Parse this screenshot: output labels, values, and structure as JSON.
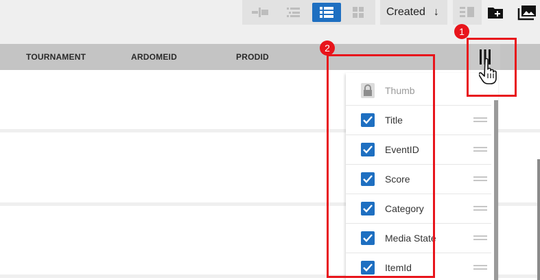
{
  "toolbar": {
    "view_buttons": [
      {
        "name": "timeline-view-icon",
        "active": false
      },
      {
        "name": "tree-list-view-icon",
        "active": false
      },
      {
        "name": "list-view-icon",
        "active": true
      },
      {
        "name": "grid-view-icon",
        "active": false
      }
    ],
    "sort": {
      "label": "Created",
      "direction_icon": "arrow-down-icon",
      "direction_glyph": "↓"
    },
    "actions": [
      "detail-view-icon",
      "new-folder-icon",
      "media-library-icon"
    ]
  },
  "table": {
    "columns": [
      "TOURNAMENT",
      "ARDOMEID",
      "PRODID"
    ],
    "column_toggle_icon": "columns-icon"
  },
  "column_chooser": {
    "options": [
      {
        "label": "Thumb",
        "checked": true,
        "locked": true
      },
      {
        "label": "Title",
        "checked": true,
        "locked": false
      },
      {
        "label": "EventID",
        "checked": true,
        "locked": false
      },
      {
        "label": "Score",
        "checked": true,
        "locked": false
      },
      {
        "label": "Category",
        "checked": true,
        "locked": false
      },
      {
        "label": "Media State",
        "checked": true,
        "locked": false
      },
      {
        "label": "ItemId",
        "checked": true,
        "locked": false
      }
    ]
  },
  "annotations": {
    "badge_1": "1",
    "badge_2": "2",
    "color": "#e8141b"
  },
  "colors": {
    "accent": "#1e6fc1",
    "header_bg": "#c4c4c4"
  }
}
